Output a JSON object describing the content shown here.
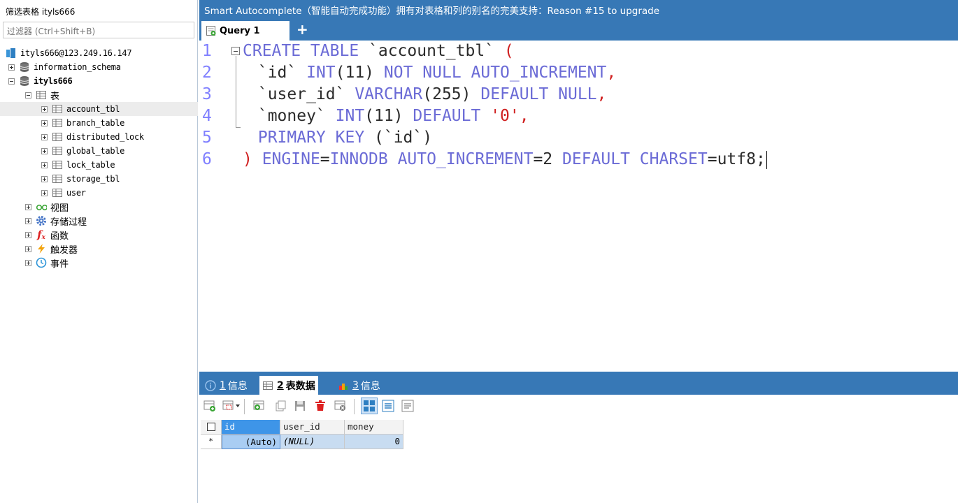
{
  "sidebar": {
    "title": "筛选表格 ityls666",
    "filter_placeholder": "过滤器 (Ctrl+Shift+B)",
    "connection": "ityls666@123.249.16.147",
    "databases": [
      {
        "name": "information_schema"
      },
      {
        "name": "ityls666"
      }
    ],
    "tables_folder": "表",
    "tables": [
      "account_tbl",
      "branch_table",
      "distributed_lock",
      "global_table",
      "lock_table",
      "storage_tbl",
      "user"
    ],
    "folders": [
      "视图",
      "存储过程",
      "函数",
      "触发器",
      "事件"
    ]
  },
  "banner": "Smart Autocomplete（智能自动完成功能）拥有对表格和列的别名的完美支持：Reason #15 to upgrade",
  "tabs": {
    "query": "Query 1",
    "add": "+"
  },
  "editor": {
    "line_numbers": [
      "1",
      "2",
      "3",
      "4",
      "5",
      "6"
    ],
    "lines": [
      [
        {
          "t": "CREATE TABLE ",
          "c": "kw"
        },
        {
          "t": "`account_tbl` ",
          "c": ""
        },
        {
          "t": "(",
          "c": "red"
        }
      ],
      [
        {
          "t": " `id` ",
          "c": ""
        },
        {
          "t": "INT",
          "c": "kw"
        },
        {
          "t": "(11) ",
          "c": ""
        },
        {
          "t": "NOT NULL AUTO_INCREMENT",
          "c": "kw"
        },
        {
          "t": ",",
          "c": "red"
        }
      ],
      [
        {
          "t": " `user_id` ",
          "c": ""
        },
        {
          "t": "VARCHAR",
          "c": "kw"
        },
        {
          "t": "(255) ",
          "c": ""
        },
        {
          "t": "DEFAULT NULL",
          "c": "kw"
        },
        {
          "t": ",",
          "c": "red"
        }
      ],
      [
        {
          "t": " `money` ",
          "c": ""
        },
        {
          "t": "INT",
          "c": "kw"
        },
        {
          "t": "(11) ",
          "c": ""
        },
        {
          "t": "DEFAULT ",
          "c": "kw"
        },
        {
          "t": "'0'",
          "c": "red"
        },
        {
          "t": ",",
          "c": "red"
        }
      ],
      [
        {
          "t": " PRIMARY KEY ",
          "c": "kw"
        },
        {
          "t": "(`id`)",
          "c": ""
        }
      ],
      [
        {
          "t": ") ",
          "c": "red"
        },
        {
          "t": "ENGINE",
          "c": "kw"
        },
        {
          "t": "=",
          "c": ""
        },
        {
          "t": "INNODB AUTO_INCREMENT",
          "c": "kw"
        },
        {
          "t": "=2 ",
          "c": ""
        },
        {
          "t": "DEFAULT CHARSET",
          "c": "kw"
        },
        {
          "t": "=utf8;",
          "c": ""
        }
      ]
    ]
  },
  "result_tabs": [
    {
      "num": "1",
      "label": "信息"
    },
    {
      "num": "2",
      "label": "表数据"
    },
    {
      "num": "3",
      "label": "信息"
    }
  ],
  "grid": {
    "columns": [
      "id",
      "user_id",
      "money"
    ],
    "row_marker": "*",
    "row": [
      "(Auto)",
      "(NULL)",
      "0"
    ]
  },
  "colors": {
    "accent": "#3778b6",
    "keyword": "#6b6bd6",
    "string": "#d02020",
    "line_number": "#7f7fff"
  }
}
